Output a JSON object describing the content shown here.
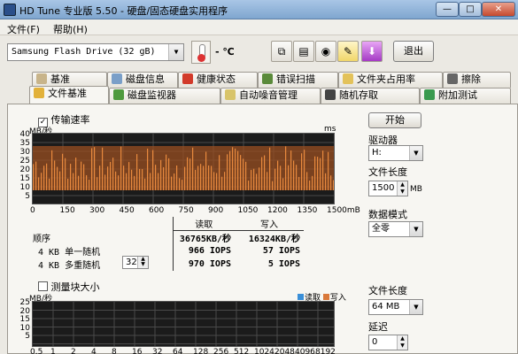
{
  "window": {
    "title": "HD Tune 专业版 5.50 - 硬盘/固态硬盘实用程序",
    "min": "—",
    "max": "□",
    "close": "✕"
  },
  "menu": {
    "file": "文件(F)",
    "help": "帮助(H)"
  },
  "toolbar": {
    "drive": "Samsung Flash Drive (32 gB)",
    "temp": "- ℃",
    "exit": "退出",
    "icons": [
      "copy-icon",
      "copy-text-icon",
      "camera-icon",
      "tools-icon",
      "save-icon"
    ]
  },
  "tabs_row1": [
    "基准",
    "磁盘信息",
    "健康状态",
    "错误扫描",
    "文件夹占用率",
    "擦除"
  ],
  "tabs_row2": [
    "文件基准",
    "磁盘监视器",
    "自动噪音管理",
    "随机存取",
    "附加测试"
  ],
  "transfer": {
    "checkbox_label": "传输速率",
    "checked": true,
    "unit_left": "MB/秒",
    "unit_right": "ms",
    "y_ticks": [
      "40",
      "35",
      "30",
      "25",
      "20",
      "15",
      "10",
      "5"
    ],
    "x_ticks": [
      "0",
      "150",
      "300",
      "450",
      "600",
      "750",
      "900",
      "1050",
      "1200",
      "1350",
      "1500mB"
    ]
  },
  "results": {
    "header_read": "读取",
    "header_write": "写入",
    "rows": [
      {
        "label": "顺序",
        "read": "36765KB/秒",
        "write": "16324KB/秒"
      },
      {
        "label": "4 KB 单一随机",
        "read": "966 IOPS",
        "write": "57 IOPS"
      },
      {
        "label": "4 KB 多重随机",
        "read": "970 IOPS",
        "write": "5 IOPS"
      }
    ],
    "queue_depth": "32"
  },
  "blocksize": {
    "checkbox_label": "测量块大小",
    "checked": false,
    "unit": "MB/秒",
    "legend_read": "读取",
    "legend_write": "写入",
    "y_ticks": [
      "25",
      "20",
      "15",
      "10",
      "5"
    ],
    "x_ticks": [
      "0.5",
      "1",
      "2",
      "4",
      "8",
      "16",
      "32",
      "64",
      "128",
      "256",
      "512",
      "1024",
      "2048",
      "4096",
      "8192"
    ]
  },
  "side": {
    "start": "开始",
    "drive_label": "驱动器",
    "drive": "H:",
    "length_label": "文件长度",
    "length": "1500",
    "length_unit": "MB",
    "pattern_label": "数据模式",
    "pattern": "全零",
    "length2_label": "文件长度",
    "length2": "64 MB",
    "delay_label": "延迟",
    "delay": "0"
  },
  "colors": {
    "read": "#3a8fd8",
    "write": "#d9783a",
    "chart_bg": "#1b1b1b"
  }
}
